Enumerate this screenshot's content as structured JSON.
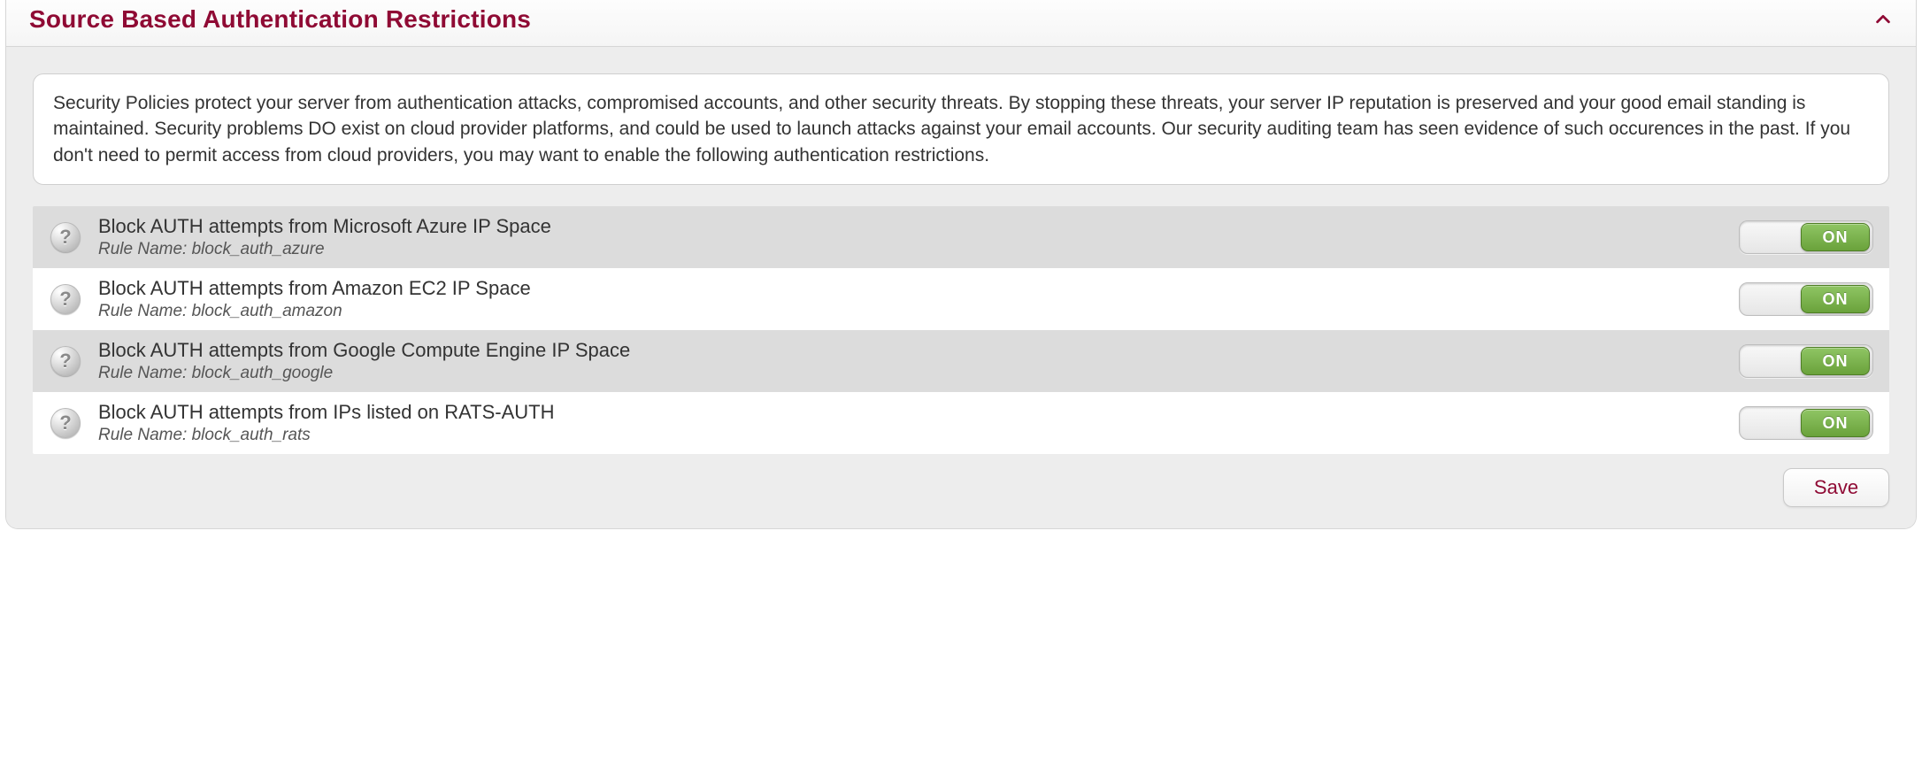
{
  "panel": {
    "title": "Source Based Authentication Restrictions",
    "description": "Security Policies protect your server from authentication attacks, compromised accounts, and other security threats. By stopping these threats, your server IP reputation is preserved and your good email standing is maintained. Security problems DO exist on cloud provider platforms, and could be used to launch attacks against your email accounts. Our security auditing team has seen evidence of such occurences in the past. If you don't need to permit access from cloud providers, you may want to enable the following authentication restrictions."
  },
  "rule_label_prefix": "Rule Name: ",
  "toggle": {
    "on_label": "ON"
  },
  "rules": [
    {
      "title": "Block AUTH attempts from Microsoft Azure IP Space",
      "rule_name": "block_auth_azure",
      "state": "ON"
    },
    {
      "title": "Block AUTH attempts from Amazon EC2 IP Space",
      "rule_name": "block_auth_amazon",
      "state": "ON"
    },
    {
      "title": "Block AUTH attempts from Google Compute Engine IP Space",
      "rule_name": "block_auth_google",
      "state": "ON"
    },
    {
      "title": "Block AUTH attempts from IPs listed on RATS-AUTH",
      "rule_name": "block_auth_rats",
      "state": "ON"
    }
  ],
  "footer": {
    "save_label": "Save"
  },
  "colors": {
    "accent": "#8f0a34",
    "toggle_on": "#6aa23b"
  }
}
